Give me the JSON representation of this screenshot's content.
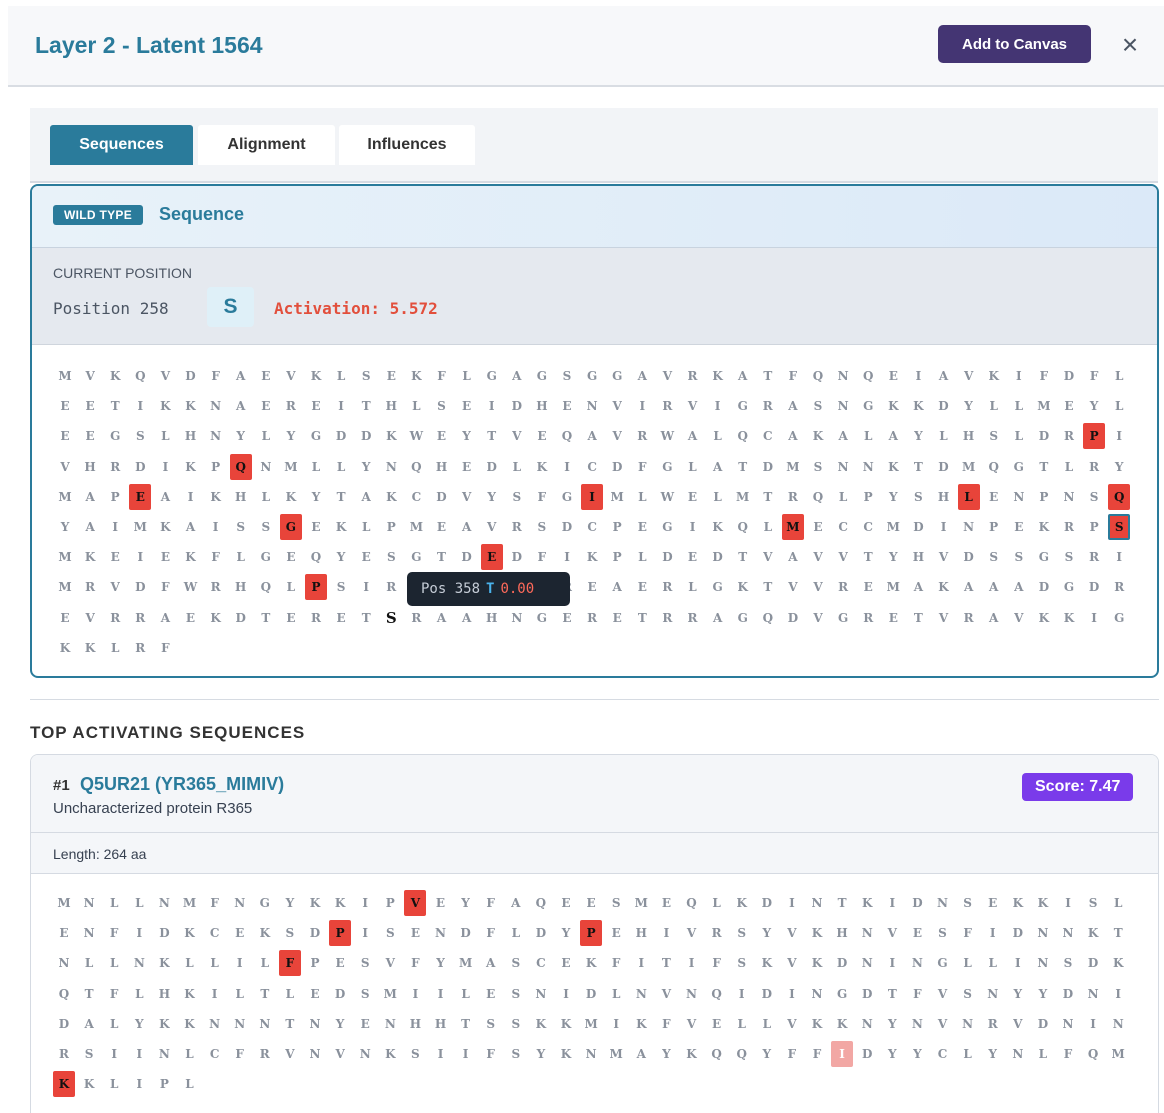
{
  "header": {
    "title": "Layer 2 - Latent 1564",
    "add_label": "Add to Canvas",
    "close_glyph": "×"
  },
  "tabs": [
    "Sequences",
    "Alignment",
    "Influences"
  ],
  "wild_type": {
    "badge": "WILD TYPE",
    "title": "Sequence",
    "current_label": "CURRENT POSITION",
    "position_text": "Position 258",
    "position_aa": "S",
    "activation_text": "Activation: 5.572",
    "sequence": "MVKQVDFAEVKLSEKFLGAGSGGAVRKATFQNQEIAVKIFDFLEETIKKNAEREITHLSEIDHENVIRVIGRASNGKKDYLLMEYLEEGSLHNYLYGDDKWEYTVEQAVRWALQCAKALAYLHSLDRPIVHRDIKPQNMLLYNQHEDLKICDFGLATDMSNNKTDMQGTLRYMAPEAIKHLKYTAKCDVYSFGIMLWELMTRQLPYSHLENPNSQYAIMKAISSGEKLPMEAVRSDCPEGIKQLMECCMDINPEKRPSMKEIEKFLGEQYESGTDEDFIKPLDEDTVAVVTYHVDSSGSRIMRVDFWRHQLPSIRYVLPTQREAERLGKTVVREMAKAAADGDREVRRAEKDTERETSRAAHNGERETRRAGQDVGRETVRAVKKIGKKLRF",
    "highlights": [
      {
        "index": 127,
        "level": 1.0
      },
      {
        "index": 136,
        "level": 1.0
      },
      {
        "index": 175,
        "level": 1.0
      },
      {
        "index": 193,
        "level": 1.0
      },
      {
        "index": 208,
        "level": 1.0
      },
      {
        "index": 214,
        "level": 1.0
      },
      {
        "index": 224,
        "level": 1.0
      },
      {
        "index": 244,
        "level": 1.0
      },
      {
        "index": 257,
        "level": 1.0
      },
      {
        "index": 275,
        "level": 1.0
      },
      {
        "index": 311,
        "level": 1.0
      }
    ],
    "selected_index": 257,
    "hover_index": 357,
    "tooltip": {
      "pos": "Pos 358",
      "aa": "T",
      "act": "0.00"
    }
  },
  "top_section": {
    "heading": "TOP ACTIVATING SEQUENCES",
    "items": [
      {
        "rank": "#1",
        "id": "Q5UR21 (YR365_MIMIV)",
        "description": "Uncharacterized protein R365",
        "score": "Score: 7.47",
        "length": "Length: 264 aa",
        "sequence": "MNLLNMFNGYKKIPVEYFAQEESMEQLKDINTKIDNSEKKISLENFIDKCEKSDPISENDFLDYPEHIVRSYVKHNVESFIDNNKTNLLNKLLILFPESVFYMASCEKFITIFSKVKDNINGLLINSDKQTFLHKILTLEDSMIILESNIDLNVNQIDINGDTFVSNYYDNIDALYKKNNNTNYENHHTSSKKMIKFVELLVKKNYNVNRVDNINRSIINLCFRVNVNKSIIFSYKNMAYKQQYFFIDYYCLYNLFQMKKLIPL",
        "highlights": [
          {
            "index": 14,
            "level": 1.0
          },
          {
            "index": 54,
            "level": 1.0
          },
          {
            "index": 64,
            "level": 1.0
          },
          {
            "index": 95,
            "level": 1.0
          },
          {
            "index": 246,
            "level": 0.4
          },
          {
            "index": 258,
            "level": 1.0
          }
        ]
      }
    ]
  },
  "colors": {
    "accent": "#2a7b9b",
    "add_button": "#443573",
    "score_badge": "#7a3bea",
    "highlight_strong": "#e8443a",
    "highlight_weak": "#f2a7a4",
    "activation_text": "#e24f3c"
  },
  "icons": {
    "close": "close-icon"
  }
}
